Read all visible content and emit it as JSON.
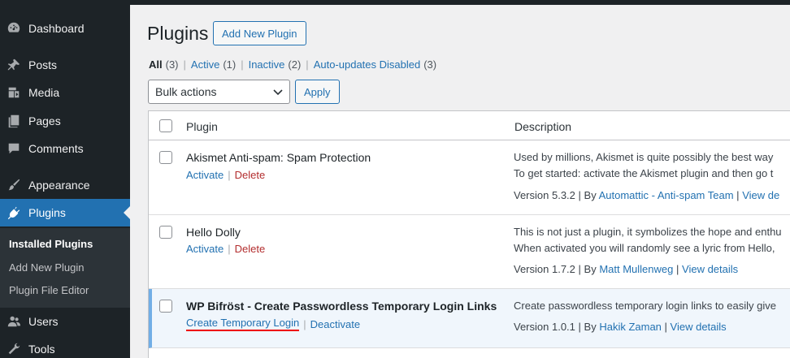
{
  "sidebar": {
    "items": [
      {
        "label": "Dashboard",
        "icon": "dashboard-icon"
      },
      {
        "label": "Posts",
        "icon": "pin-icon"
      },
      {
        "label": "Media",
        "icon": "media-icon"
      },
      {
        "label": "Pages",
        "icon": "pages-icon"
      },
      {
        "label": "Comments",
        "icon": "comment-icon"
      },
      {
        "label": "Appearance",
        "icon": "brush-icon"
      },
      {
        "label": "Plugins",
        "icon": "plugin-icon"
      },
      {
        "label": "Users",
        "icon": "users-icon"
      },
      {
        "label": "Tools",
        "icon": "wrench-icon"
      }
    ],
    "submenu": [
      "Installed Plugins",
      "Add New Plugin",
      "Plugin File Editor"
    ]
  },
  "header": {
    "title": "Plugins",
    "add_new": "Add New Plugin"
  },
  "filters": {
    "all": {
      "label": "All",
      "count": "(3)"
    },
    "active": {
      "label": "Active",
      "count": "(1)"
    },
    "inactive": {
      "label": "Inactive",
      "count": "(2)"
    },
    "autoupdates": {
      "label": "Auto-updates Disabled",
      "count": "(3)"
    },
    "separator": "|"
  },
  "bulk": {
    "selected": "Bulk actions",
    "apply": "Apply"
  },
  "table": {
    "col_plugin": "Plugin",
    "col_description": "Description",
    "action_separator": "|",
    "meta_separator": "|",
    "rows": [
      {
        "name": "Akismet Anti-spam: Spam Protection",
        "action1": "Activate",
        "action2": "Delete",
        "desc1": "Used by millions, Akismet is quite possibly the best way",
        "desc2": "To get started: activate the Akismet plugin and then go t",
        "version": "Version 5.3.2",
        "by": "By",
        "author": "Automattic - Anti-spam Team",
        "details": "View de"
      },
      {
        "name": "Hello Dolly",
        "action1": "Activate",
        "action2": "Delete",
        "desc1": "This is not just a plugin, it symbolizes the hope and enthu",
        "desc2": "When activated you will randomly see a lyric from Hello,",
        "version": "Version 1.7.2",
        "by": "By",
        "author": "Matt Mullenweg",
        "details": "View details"
      },
      {
        "name": "WP Bifröst - Create Passwordless Temporary Login Links",
        "action1": "Create Temporary Login",
        "action2": "Deactivate",
        "desc1": "Create passwordless temporary login links to easily give",
        "version": "Version 1.0.1",
        "by": "By",
        "author": "Hakik Zaman",
        "details": "View details"
      }
    ]
  },
  "colors": {
    "sidebar_bg": "#1d2327",
    "accent": "#2271b1",
    "delete": "#b32d2e",
    "active_row": "#f0f6fc",
    "highlight": "#e00000"
  }
}
